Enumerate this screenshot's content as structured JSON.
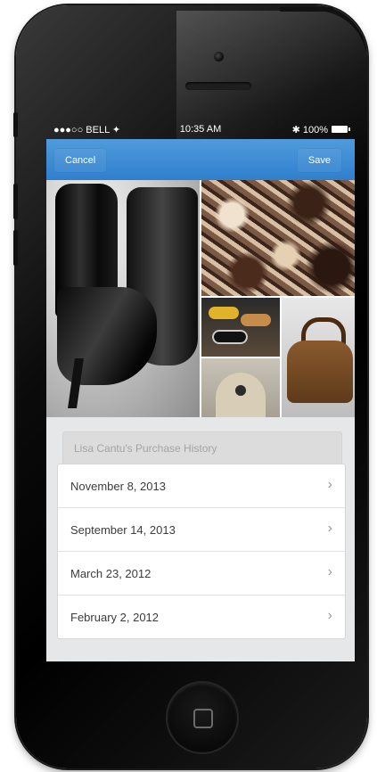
{
  "status_bar": {
    "carrier": "●●●○○ BELL ✦",
    "time": "10:35 AM",
    "battery": "✱ 100%"
  },
  "nav": {
    "cancel": "Cancel",
    "save": "Save"
  },
  "history": {
    "title": "Lisa Cantu's Purchase History",
    "items": [
      {
        "label": "November 8, 2013"
      },
      {
        "label": "September 14, 2013"
      },
      {
        "label": "March 23, 2012"
      },
      {
        "label": "February 2, 2012"
      }
    ]
  },
  "colors": {
    "nav_blue": "#3b8ad6",
    "screen_bg": "#e6e7e8"
  },
  "icons": {
    "chevron": "chevron-right-icon",
    "home": "home-button-icon"
  }
}
